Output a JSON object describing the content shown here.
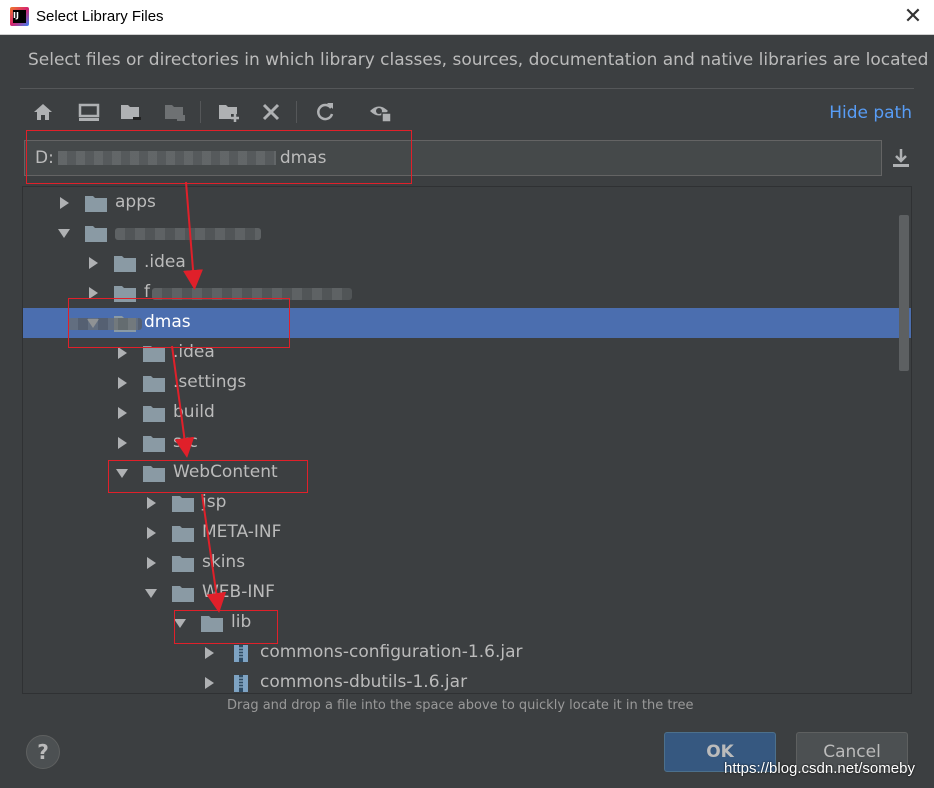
{
  "window": {
    "title": "Select Library Files"
  },
  "description": "Select files or directories in which library classes, sources, documentation and native libraries are located",
  "toolbar": {
    "buttons": [
      {
        "icon": "home-icon"
      },
      {
        "icon": "desktop-icon"
      },
      {
        "icon": "project-folder-icon"
      },
      {
        "icon": "module-folder-icon"
      },
      {
        "icon": "new-folder-icon"
      },
      {
        "icon": "delete-icon"
      },
      {
        "icon": "refresh-icon"
      },
      {
        "icon": "show-hidden-icon"
      }
    ],
    "hide_path_label": "Hide path"
  },
  "path_field": {
    "prefix": "D:",
    "suffix": "dmas"
  },
  "tree": {
    "rows": [
      {
        "label": "apps",
        "expanded": false,
        "type": "folder"
      },
      {
        "label": "",
        "expanded": true,
        "type": "folder"
      },
      {
        "label": ".idea",
        "expanded": false,
        "type": "folder"
      },
      {
        "label": "f",
        "expanded": false,
        "type": "folder"
      },
      {
        "label": "dmas",
        "expanded": true,
        "type": "folder",
        "selected": true
      },
      {
        "label": ".idea",
        "expanded": false,
        "type": "folder"
      },
      {
        "label": ".settings",
        "expanded": false,
        "type": "folder"
      },
      {
        "label": "build",
        "expanded": false,
        "type": "folder"
      },
      {
        "label": "src",
        "expanded": false,
        "type": "folder"
      },
      {
        "label": "WebContent",
        "expanded": true,
        "type": "folder"
      },
      {
        "label": "jsp",
        "expanded": false,
        "type": "folder"
      },
      {
        "label": "META-INF",
        "expanded": false,
        "type": "folder"
      },
      {
        "label": "skins",
        "expanded": false,
        "type": "folder"
      },
      {
        "label": "WEB-INF",
        "expanded": true,
        "type": "folder"
      },
      {
        "label": "lib",
        "expanded": true,
        "type": "folder"
      },
      {
        "label": "commons-configuration-1.6.jar",
        "expanded": false,
        "type": "jar"
      },
      {
        "label": "commons-dbutils-1.6.jar",
        "expanded": false,
        "type": "jar"
      }
    ]
  },
  "hint": "Drag and drop a file into the space above to quickly locate it in the tree",
  "buttons": {
    "help": "?",
    "ok": "OK",
    "cancel": "Cancel"
  },
  "watermark": "https://blog.csdn.net/someby",
  "colors": {
    "background": "#3c3f41",
    "selection": "#4b6eaf",
    "link": "#589df6",
    "annotation": "#e0202a",
    "folder": "#8a9aa4"
  }
}
